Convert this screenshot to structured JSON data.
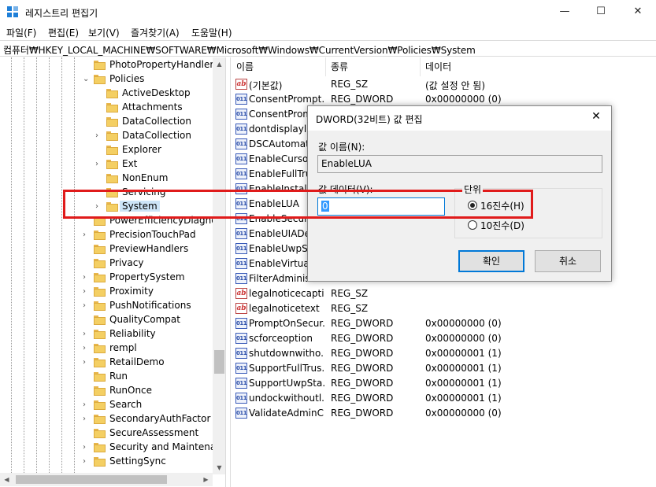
{
  "window": {
    "title": "레지스트리 편집기",
    "minimize": "—",
    "maximize": "☐",
    "close": "✕"
  },
  "menu": [
    "파일(F)",
    "편집(E)",
    "보기(V)",
    "즐겨찾기(A)",
    "도움말(H)"
  ],
  "address": "컴퓨터₩HKEY_LOCAL_MACHINE₩SOFTWARE₩Microsoft₩Windows₩CurrentVersion₩Policies₩System",
  "tree": {
    "items": [
      {
        "label": "PhotoPropertyHandler",
        "level": 0,
        "expander": ""
      },
      {
        "label": "Policies",
        "level": 0,
        "expander": "⌄"
      },
      {
        "label": "ActiveDesktop",
        "level": 1,
        "expander": ""
      },
      {
        "label": "Attachments",
        "level": 1,
        "expander": ""
      },
      {
        "label": "DataCollection",
        "level": 1,
        "expander": ""
      },
      {
        "label": "DataCollection",
        "level": 1,
        "expander": "›"
      },
      {
        "label": "Explorer",
        "level": 1,
        "expander": ""
      },
      {
        "label": "Ext",
        "level": 1,
        "expander": "›"
      },
      {
        "label": "NonEnum",
        "level": 1,
        "expander": ""
      },
      {
        "label": "Servicing",
        "level": 1,
        "expander": ""
      },
      {
        "label": "System",
        "level": 1,
        "expander": "›",
        "selected": true
      },
      {
        "label": "PowerEfficiencyDiagnost",
        "level": 0,
        "expander": ""
      },
      {
        "label": "PrecisionTouchPad",
        "level": 0,
        "expander": "›"
      },
      {
        "label": "PreviewHandlers",
        "level": 0,
        "expander": ""
      },
      {
        "label": "Privacy",
        "level": 0,
        "expander": ""
      },
      {
        "label": "PropertySystem",
        "level": 0,
        "expander": "›"
      },
      {
        "label": "Proximity",
        "level": 0,
        "expander": "›"
      },
      {
        "label": "PushNotifications",
        "level": 0,
        "expander": "›"
      },
      {
        "label": "QualityCompat",
        "level": 0,
        "expander": ""
      },
      {
        "label": "Reliability",
        "level": 0,
        "expander": "›"
      },
      {
        "label": "rempl",
        "level": 0,
        "expander": "›"
      },
      {
        "label": "RetailDemo",
        "level": 0,
        "expander": "›"
      },
      {
        "label": "Run",
        "level": 0,
        "expander": ""
      },
      {
        "label": "RunOnce",
        "level": 0,
        "expander": ""
      },
      {
        "label": "Search",
        "level": 0,
        "expander": "›"
      },
      {
        "label": "SecondaryAuthFactor",
        "level": 0,
        "expander": "›"
      },
      {
        "label": "SecureAssessment",
        "level": 0,
        "expander": ""
      },
      {
        "label": "Security and Maintenanc",
        "level": 0,
        "expander": "›"
      },
      {
        "label": "SettingSync",
        "level": 0,
        "expander": "›"
      }
    ]
  },
  "columns": {
    "name": "이름",
    "type": "종류",
    "data": "데이터"
  },
  "values": [
    {
      "icon": "sz",
      "name": "(기본값)",
      "type": "REG_SZ",
      "data": "(값 설정 안 됨)"
    },
    {
      "icon": "bin",
      "name": "ConsentPrompt...",
      "type": "REG_DWORD",
      "data": "0x00000000 (0)"
    },
    {
      "icon": "bin",
      "name": "ConsentPromp",
      "type": "",
      "data": ""
    },
    {
      "icon": "bin",
      "name": "dontdisplaylas",
      "type": "",
      "data": ""
    },
    {
      "icon": "bin",
      "name": "DSCAutomati",
      "type": "",
      "data": ""
    },
    {
      "icon": "bin",
      "name": "EnableCursorS",
      "type": "",
      "data": ""
    },
    {
      "icon": "bin",
      "name": "EnableFullTrus",
      "type": "",
      "data": ""
    },
    {
      "icon": "bin",
      "name": "EnableInstaller",
      "type": "",
      "data": ""
    },
    {
      "icon": "bin",
      "name": "EnableLUA",
      "type": "",
      "data": ""
    },
    {
      "icon": "bin",
      "name": "EnableSecure",
      "type": "",
      "data": ""
    },
    {
      "icon": "bin",
      "name": "EnableUIADes",
      "type": "",
      "data": ""
    },
    {
      "icon": "bin",
      "name": "EnableUwpSta",
      "type": "",
      "data": ""
    },
    {
      "icon": "bin",
      "name": "EnableVirtualiz",
      "type": "",
      "data": ""
    },
    {
      "icon": "bin",
      "name": "FilterAdminist",
      "type": "",
      "data": ""
    },
    {
      "icon": "sz",
      "name": "legalnoticecapti...",
      "type": "REG_SZ",
      "data": ""
    },
    {
      "icon": "sz",
      "name": "legalnoticetext",
      "type": "REG_SZ",
      "data": ""
    },
    {
      "icon": "bin",
      "name": "PromptOnSecur...",
      "type": "REG_DWORD",
      "data": "0x00000000 (0)"
    },
    {
      "icon": "bin",
      "name": "scforceoption",
      "type": "REG_DWORD",
      "data": "0x00000000 (0)"
    },
    {
      "icon": "bin",
      "name": "shutdownwitho...",
      "type": "REG_DWORD",
      "data": "0x00000001 (1)"
    },
    {
      "icon": "bin",
      "name": "SupportFullTrus...",
      "type": "REG_DWORD",
      "data": "0x00000001 (1)"
    },
    {
      "icon": "bin",
      "name": "SupportUwpSta...",
      "type": "REG_DWORD",
      "data": "0x00000001 (1)"
    },
    {
      "icon": "bin",
      "name": "undockwithoutl...",
      "type": "REG_DWORD",
      "data": "0x00000001 (1)"
    },
    {
      "icon": "bin",
      "name": "ValidateAdminC...",
      "type": "REG_DWORD",
      "data": "0x00000000 (0)"
    }
  ],
  "icon_glyphs": {
    "sz": "ab",
    "bin": "011"
  },
  "dialog": {
    "title": "DWORD(32비트) 값 편집",
    "name_label": "값 이름(N):",
    "name_value": "EnableLUA",
    "data_label": "값 데이터(V):",
    "data_value": "0",
    "base_label": "단위",
    "hex_label": "16진수(H)",
    "dec_label": "10진수(D)",
    "ok": "확인",
    "cancel": "취소",
    "close": "✕"
  },
  "colors": {
    "highlight": "#e01b1b",
    "selection": "#cce4f7",
    "accent": "#0078d7"
  }
}
